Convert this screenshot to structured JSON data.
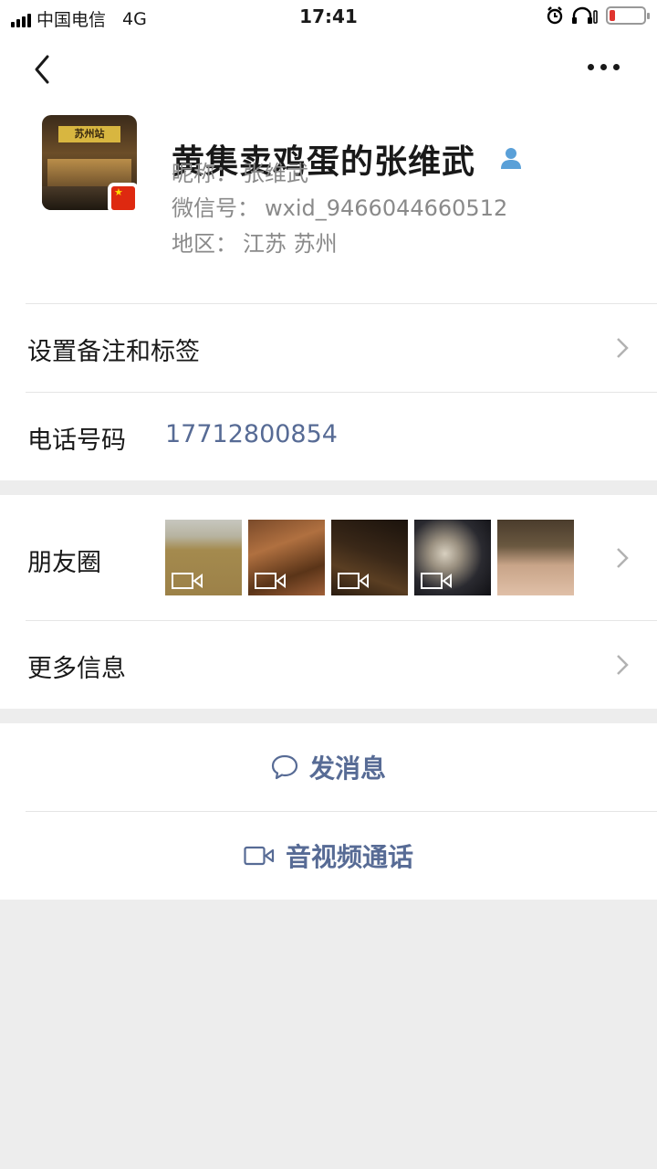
{
  "status_bar": {
    "carrier": "中国电信",
    "network": "4G",
    "time": "17:41"
  },
  "profile": {
    "display_name": "黄集卖鸡蛋的张维武",
    "avatar_sign_text": "苏州站",
    "nickname_label": "昵称：",
    "nickname": "张维武",
    "wechat_id_label": "微信号：",
    "wechat_id": "wxid_9466044660512",
    "region_label": "地区：",
    "region": "江苏 苏州"
  },
  "rows": {
    "remark_tags": "设置备注和标签",
    "phone_label": "电话号码",
    "phone_number": "17712800854",
    "moments": "朋友圈",
    "more_info": "更多信息"
  },
  "actions": {
    "send_message": "发消息",
    "video_call": "音视频通话"
  },
  "colors": {
    "link": "#576b95",
    "background": "#ededed",
    "gender_male": "#5aa0d8"
  },
  "icons": [
    "back-arrow-icon",
    "more-dots-icon",
    "male-gender-icon",
    "china-flag-icon",
    "chevron-right-icon",
    "video-icon",
    "chat-bubble-icon",
    "video-call-icon",
    "alarm-icon",
    "headphones-icon",
    "battery-icon"
  ]
}
